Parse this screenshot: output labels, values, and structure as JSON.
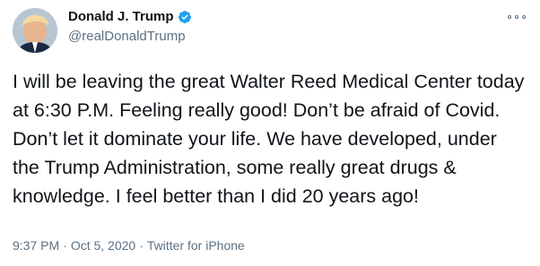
{
  "author": {
    "display_name": "Donald J. Trump",
    "handle": "@realDonaldTrump",
    "verified": true
  },
  "tweet": {
    "text": "I will be leaving the great Walter Reed Medical Center today at 6:30 P.M. Feeling really good! Don’t be afraid of Covid. Don’t let it dominate your life. We have developed, under the Trump Administration, some really great drugs & knowledge. I feel better than I did 20 years ago!",
    "time": "9:37 PM",
    "date": "Oct 5, 2020",
    "source": "Twitter for iPhone",
    "separator": "·"
  },
  "icons": {
    "verified": "verified-badge-icon",
    "more": "more-options-icon"
  },
  "colors": {
    "text": "#0f1419",
    "secondary": "#5b7083",
    "verified": "#1da1f2"
  }
}
